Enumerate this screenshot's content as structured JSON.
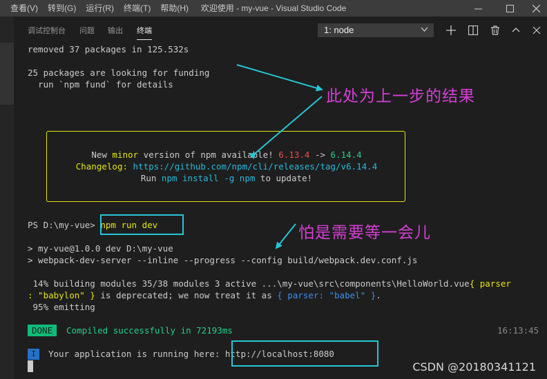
{
  "menu": [
    "查看(V)",
    "转到(G)",
    "运行(R)",
    "终端(T)",
    "帮助(H)"
  ],
  "window_title": "欢迎使用 - my-vue - Visual Studio Code",
  "panel": {
    "tabs": [
      "调试控制台",
      "问题",
      "输出",
      "终端"
    ],
    "active_tab": "终端",
    "terminal_select": "1: node"
  },
  "terminal": {
    "removed_line": "removed 37 packages in 125.532s",
    "funding_line1": "25 packages are looking for funding",
    "funding_line2": "  run `npm fund` for details",
    "notice": {
      "part1": "New ",
      "minor": "minor",
      "part2": " version of npm available! ",
      "old_version": "6.13.4",
      "arrow": " -> ",
      "new_version": "6.14.4",
      "changelog_label": "Changelog: ",
      "changelog_url": "https://github.com/npm/cli/releases/tag/v6.14.4",
      "run_label": "Run ",
      "run_cmd": "npm install -g npm",
      "run_suffix": " to update!"
    },
    "prompt": "PS D:\\my-vue> ",
    "command": "npm run dev",
    "script_line1": "> my-vue@1.0.0 dev D:\\my-vue",
    "script_line2": "> webpack-dev-server --inline --progress --config build/webpack.dev.conf.js",
    "building_a": " 14% building modules 35/38 modules 3 active ...\\my-vue\\src\\components\\HelloWorld.vue",
    "building_b": "{ parser",
    "building_c": ": \"babylon\" }",
    "building_d": " is deprecated; we now treat it as ",
    "building_e": "{ parser: \"babel\" }",
    "building_f": ".",
    "emitting": " 95% emitting",
    "done_badge": "DONE",
    "compiled": "Compiled successfully in 72193ms",
    "timestamp": "16:13:45",
    "info_badge": "I",
    "running_text": "Your application is running here: ",
    "url": "http://localhost:8080"
  },
  "annotations": {
    "previous_step": "此处为上一步的结果",
    "wait": "怕是需要等一会儿"
  },
  "watermark": "CSDN @20180341121",
  "colors": {
    "annotation_text": "#d63fd6",
    "highlight_box": "#27c6d6",
    "arrow": "#27c6d6"
  }
}
